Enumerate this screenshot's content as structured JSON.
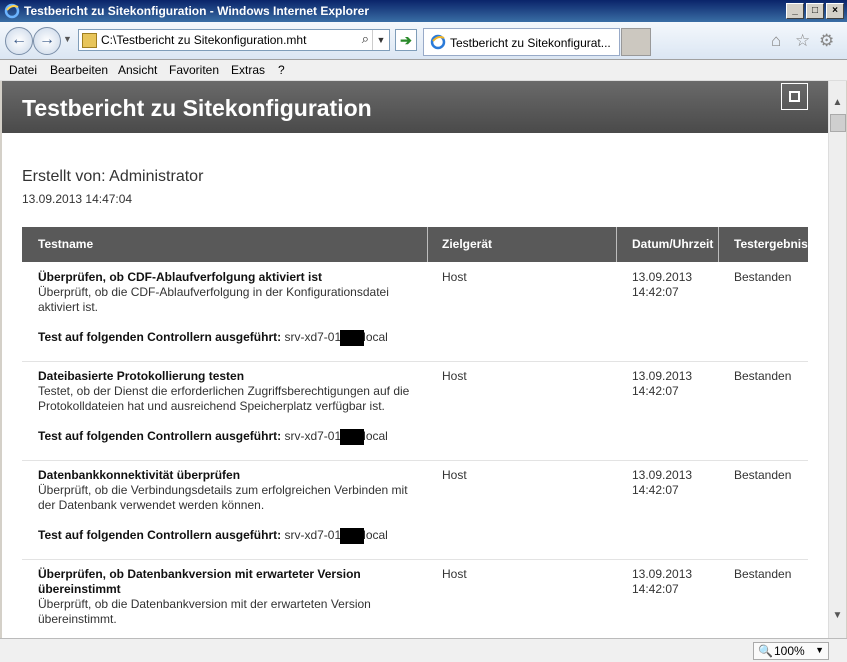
{
  "window": {
    "title": "Testbericht zu Sitekonfiguration - Windows Internet Explorer"
  },
  "address": {
    "value": "C:\\Testbericht zu Sitekonfiguration.mht"
  },
  "tab": {
    "label": "Testbericht zu Sitekonfigurat..."
  },
  "menu": {
    "items": [
      "Datei",
      "Bearbeiten",
      "Ansicht",
      "Favoriten",
      "Extras",
      "?"
    ]
  },
  "report": {
    "title": "Testbericht zu Sitekonfiguration",
    "created_by": "Erstellt von: Administrator",
    "created_at": "13.09.2013 14:47:04",
    "columns": [
      "Testname",
      "Zielgerät",
      "Datum/Uhrzeit",
      "Testergebnis"
    ],
    "controller_label": "Test auf folgenden Controllern ausgeführt:",
    "controller_prefix": "srv-xd7-01",
    "controller_suffix": "local",
    "rows": [
      {
        "name": "Überprüfen, ob CDF-Ablaufverfolgung aktiviert ist",
        "desc": "Überprüft, ob die CDF-Ablaufverfolgung in der Konfigurationsdatei aktiviert ist.",
        "target": "Host",
        "date": "13.09.2013",
        "time": "14:42:07",
        "result": "Bestanden"
      },
      {
        "name": "Dateibasierte Protokollierung testen",
        "desc": "Testet, ob der Dienst die erforderlichen Zugriffsberechtigungen auf die Protokolldateien hat und ausreichend Speicherplatz verfügbar ist.",
        "target": "Host",
        "date": "13.09.2013",
        "time": "14:42:07",
        "result": "Bestanden"
      },
      {
        "name": "Datenbankkonnektivität überprüfen",
        "desc": "Überprüft, ob die Verbindungsdetails zum erfolgreichen Verbinden mit der Datenbank verwendet werden können.",
        "target": "Host",
        "date": "13.09.2013",
        "time": "14:42:07",
        "result": "Bestanden"
      },
      {
        "name": "Überprüfen, ob Datenbankversion mit erwarteter Version übereinstimmt",
        "desc": "Überprüft, ob die Datenbankversion mit der erwarteten Version übereinstimmt.",
        "target": "Host",
        "date": "13.09.2013",
        "time": "14:42:07",
        "result": "Bestanden"
      }
    ]
  },
  "status": {
    "zoom": "100%"
  },
  "icons": [
    "ie-icon",
    "back-icon",
    "forward-icon",
    "search-icon",
    "go-icon",
    "home-icon",
    "star-icon",
    "gear-icon",
    "zoom-icon"
  ]
}
